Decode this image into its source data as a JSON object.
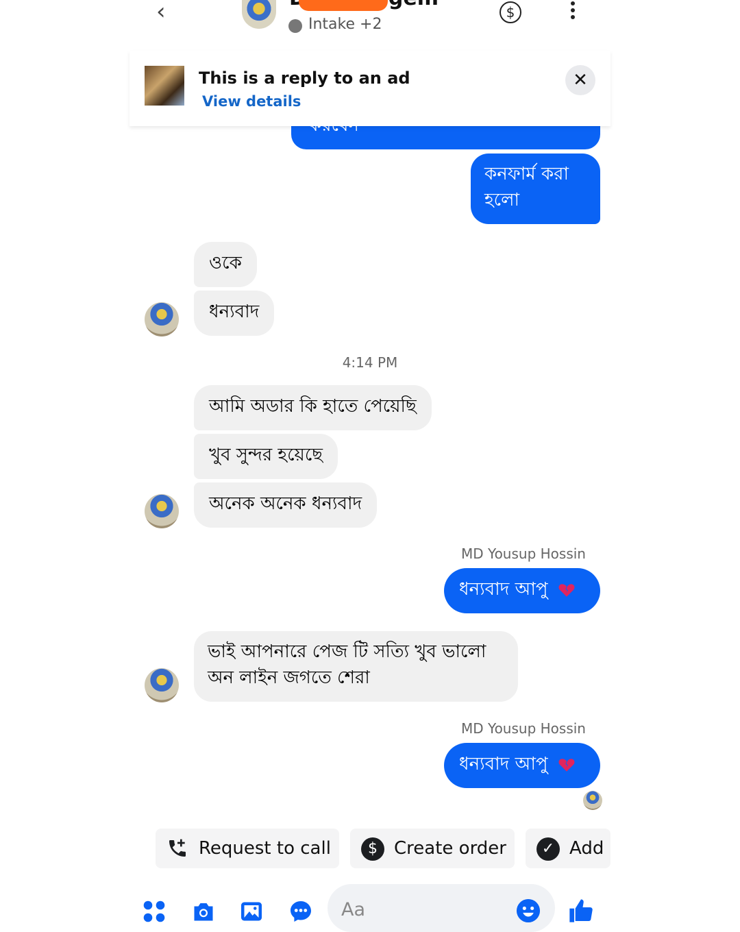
{
  "header": {
    "back_label": "‹",
    "contact_name": "D…………gem",
    "status_text": "Intake +2",
    "dollar_label": "$"
  },
  "banner": {
    "title": "This is a reply to an ad",
    "link": "View details",
    "close_label": "✕"
  },
  "messages": {
    "partial_out": "করবেন",
    "out_confirm": "কনফার্ম করা হলো",
    "out_confirm_line1": "কনফার্ম করা",
    "out_confirm_line2": "হলো",
    "in_1": "ওকে",
    "in_2": "ধন্যবাদ",
    "timestamp": "4:14 PM",
    "in_3": "আমি অডার কি হাতে পেয়েছি",
    "in_4": "খুব সুন্দর হয়েছে",
    "in_5": "অনেক অনেক ধন্যবাদ",
    "sender_1": "MD Yousup Hossin",
    "out_thanks_1": "ধন্যবাদ আপু",
    "in_6_line1": "ভাই আপনারে পেজ টি সত্যি খুব ভালো",
    "in_6_line2": "অন লাইন জগতে শেরা",
    "sender_2": "MD Yousup Hossin",
    "out_thanks_2": "ধন্যবাদ আপু"
  },
  "actions": {
    "request_call": "Request to call",
    "create_order": "Create order",
    "add": "Add"
  },
  "composer": {
    "placeholder": "Aa"
  },
  "colors": {
    "accent": "#0a63f5",
    "incoming_bubble": "#f0f0f0",
    "link": "#1466c8"
  },
  "icons": [
    "back-icon",
    "dollar-icon",
    "more-icon",
    "close-icon",
    "broken-heart-icon",
    "phone-plus-icon",
    "dollar-circle-icon",
    "check-circle-icon",
    "apps-icon",
    "camera-icon",
    "gallery-icon",
    "chat-dots-icon",
    "smile-icon",
    "like-icon"
  ]
}
